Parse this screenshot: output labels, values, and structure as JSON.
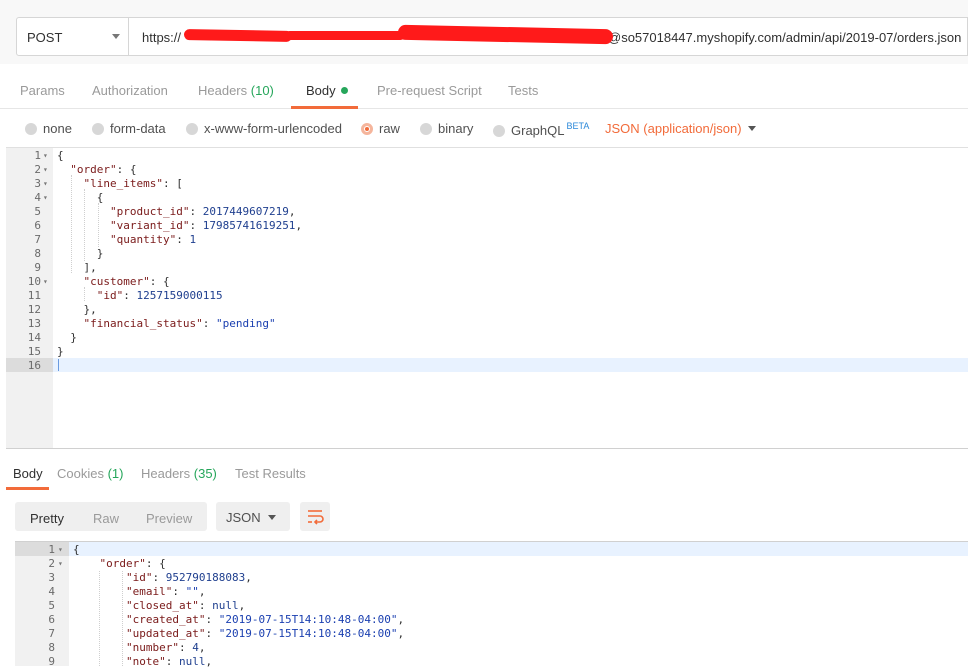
{
  "request": {
    "method": "POST",
    "url_prefix": "https://",
    "url_suffix": "@so57018447.myshopify.com/admin/api/2019-07/orders.json",
    "tabs": [
      {
        "label": "Params",
        "count": ""
      },
      {
        "label": "Authorization",
        "count": ""
      },
      {
        "label": "Headers",
        "count": "(10)"
      },
      {
        "label": "Body",
        "count": ""
      },
      {
        "label": "Pre-request Script",
        "count": ""
      },
      {
        "label": "Tests",
        "count": ""
      }
    ],
    "active_tab": "Body",
    "body_types": [
      "none",
      "form-data",
      "x-www-form-urlencoded",
      "raw",
      "binary",
      "GraphQL"
    ],
    "selected_body_type": "raw",
    "graphql_badge": "BETA",
    "content_type": "JSON (application/json)",
    "editor_lines": [
      "{",
      "  \"order\": {",
      "    \"line_items\": [",
      "      {",
      "        \"product_id\": 2017449607219,",
      "        \"variant_id\": 17985741619251,",
      "        \"quantity\": 1",
      "      }",
      "    ],",
      "    \"customer\": {",
      "      \"id\": 1257159000115",
      "    },",
      "    \"financial_status\": \"pending\"",
      "  }",
      "}",
      ""
    ]
  },
  "response": {
    "tabs": [
      {
        "label": "Body",
        "count": ""
      },
      {
        "label": "Cookies",
        "count": "(1)"
      },
      {
        "label": "Headers",
        "count": "(35)"
      },
      {
        "label": "Test Results",
        "count": ""
      }
    ],
    "format_buttons": [
      "Pretty",
      "Raw",
      "Preview"
    ],
    "active_format": "Pretty",
    "language": "JSON",
    "editor_lines": [
      "{",
      "    \"order\": {",
      "        \"id\": 952790188083,",
      "        \"email\": \"\",",
      "        \"closed_at\": null,",
      "        \"created_at\": \"2019-07-15T14:10:48-04:00\",",
      "        \"updated_at\": \"2019-07-15T14:10:48-04:00\",",
      "        \"number\": 4,",
      "        \"note\": null,"
    ]
  },
  "colors": {
    "accent": "#f26b3a",
    "count_green": "#26a65b",
    "beta_blue": "#2b89d9",
    "redaction": "#ff1a1a"
  }
}
